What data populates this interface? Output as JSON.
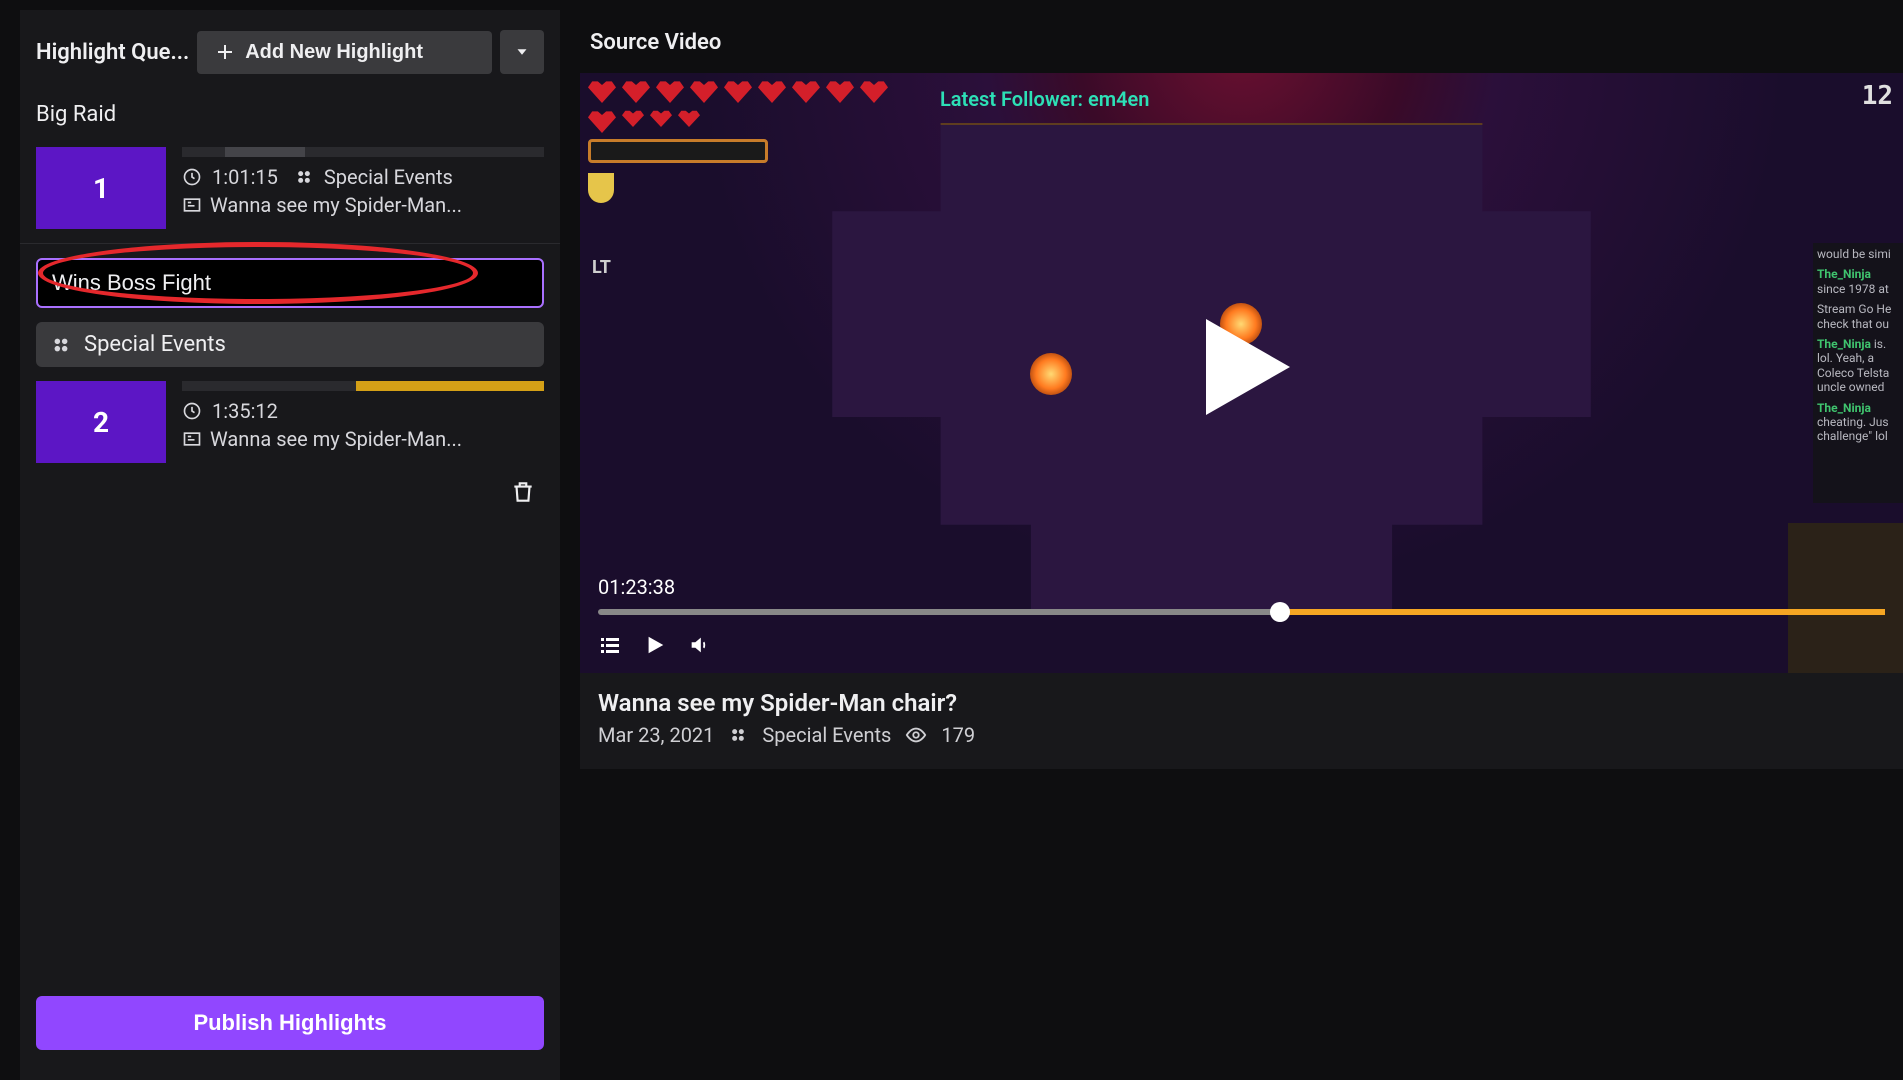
{
  "sidebar": {
    "queue_title": "Highlight Que...",
    "add_label": "Add New Highlight",
    "section1_title": "Big Raid",
    "item1": {
      "number": "1",
      "duration": "1:01:15",
      "category": "Special Events",
      "desc": "Wanna see my Spider-Man..."
    },
    "edit_title_value": "Wins Boss Fight",
    "edit_category": "Special Events",
    "item2": {
      "number": "2",
      "duration": "1:35:12",
      "desc": "Wanna see my Spider-Man..."
    },
    "publish_label": "Publish Highlights"
  },
  "main": {
    "title": "Source Video",
    "follower_label": "Latest Follower: em4en",
    "counter": "12",
    "lt": "LT",
    "time": "01:23:38",
    "video_title": "Wanna see my Spider-Man chair?",
    "video_date": "Mar 23, 2021",
    "video_category": "Special Events",
    "video_views": "179",
    "chat": [
      {
        "name": "",
        "text": "would be simi"
      },
      {
        "name": "The_Ninja",
        "text": "since 1978 at"
      },
      {
        "name": "",
        "text": "Stream Go He check that ou"
      },
      {
        "name": "The_Ninja",
        "text": "is. lol. Yeah, a Coleco Telsta uncle owned"
      },
      {
        "name": "The_Ninja",
        "text": "cheating. Jus challenge\" lol"
      }
    ]
  }
}
